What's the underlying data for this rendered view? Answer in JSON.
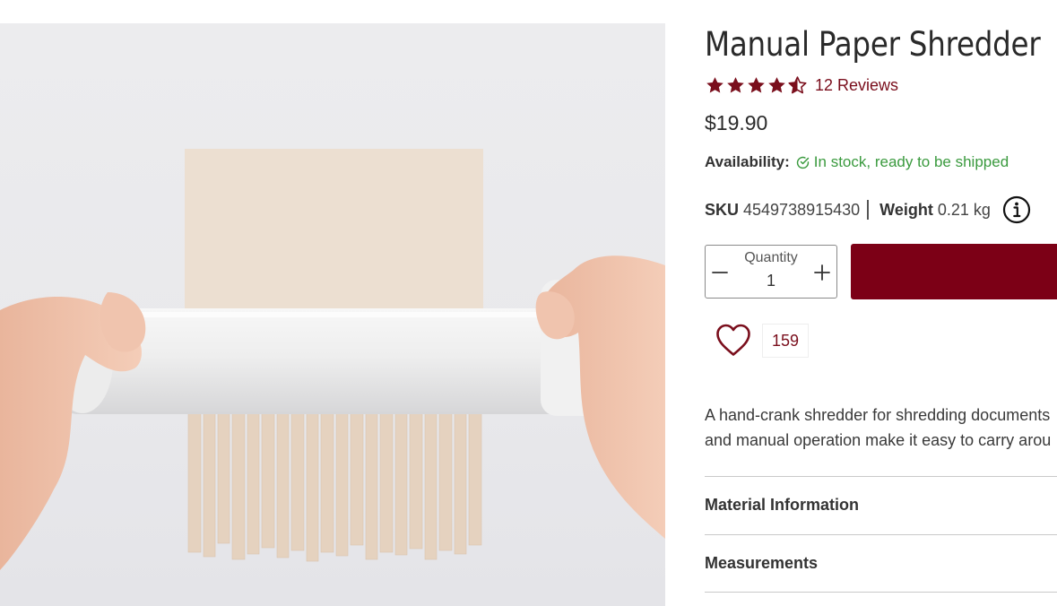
{
  "product": {
    "title": "Manual Paper Shredder",
    "rating": {
      "value": 4.5,
      "max": 5,
      "reviews_label": "12 Reviews"
    },
    "price": "$19.90",
    "availability": {
      "label": "Availability:",
      "value": "In stock, ready to be shipped",
      "icon": "check-circle-icon"
    },
    "sku": {
      "label": "SKU",
      "value": "4549738915430"
    },
    "weight": {
      "label": "Weight",
      "value": "0.21 kg"
    },
    "quantity": {
      "label": "Quantity",
      "value": "1"
    },
    "wishlist_count": "159",
    "description": [
      "A hand-crank shredder for shredding documents",
      "and manual operation make it easy to carry arou"
    ],
    "accordion": [
      {
        "label": "Material Information"
      },
      {
        "label": "Measurements"
      }
    ]
  },
  "colors": {
    "brand": "#7c0016",
    "star": "#7a0e1c",
    "in_stock": "#3a9a3e",
    "text": "#333333",
    "divider": "#c9c9c9"
  },
  "icons": {
    "stars": "star-icon",
    "info": "info-icon",
    "quantity_decrease": "minus-icon",
    "quantity_increase": "plus-icon",
    "wishlist": "heart-icon"
  }
}
